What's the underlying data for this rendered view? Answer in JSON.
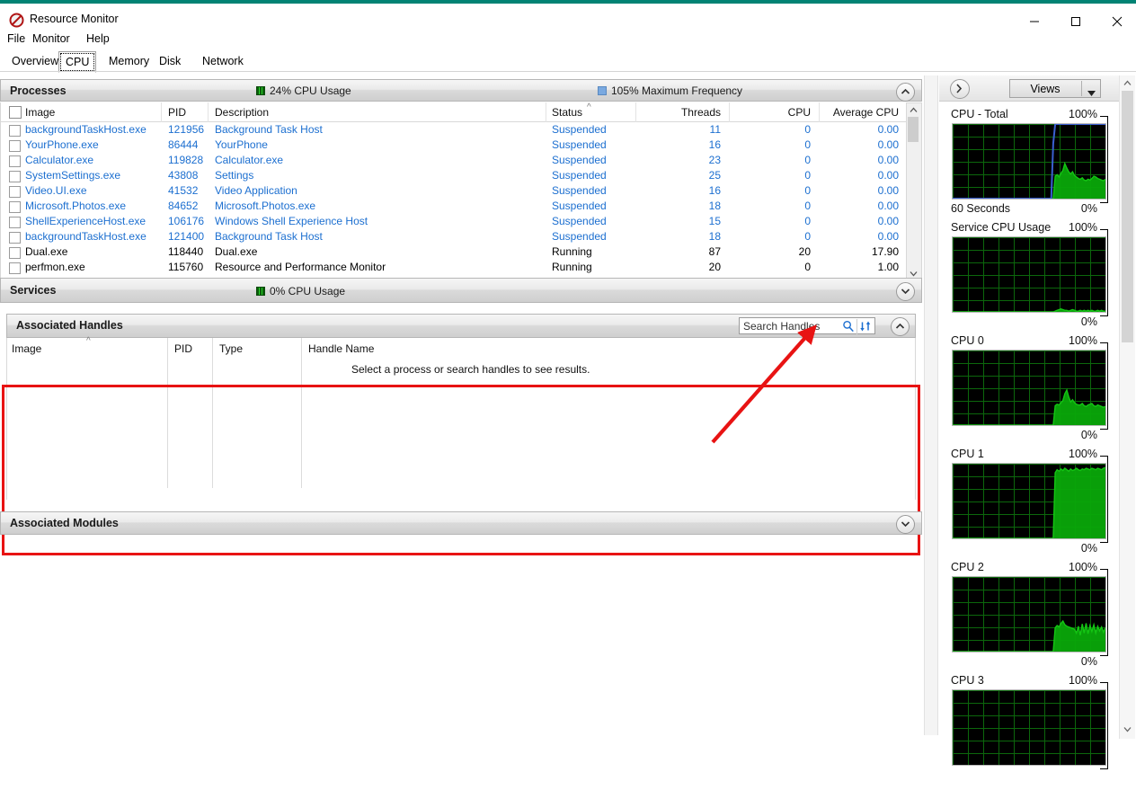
{
  "window": {
    "title": "Resource Monitor",
    "icon": "resource-monitor-icon",
    "minimize": "minimize-icon",
    "maximize": "maximize-icon",
    "close": "close-icon"
  },
  "menu": {
    "items": [
      "File",
      "Monitor",
      "Help"
    ]
  },
  "tabs": {
    "items": [
      "Overview",
      "CPU",
      "Memory",
      "Disk",
      "Network"
    ],
    "selected": "CPU"
  },
  "processes_panel": {
    "title": "Processes",
    "cpu_usage": "24% CPU Usage",
    "max_frequency": "105% Maximum Frequency",
    "collapse_icon": "chevron-up-icon",
    "columns": [
      "Image",
      "PID",
      "Description",
      "Status",
      "Threads",
      "CPU",
      "Average CPU"
    ],
    "sorted_column": "Status",
    "rows": [
      {
        "image": "backgroundTaskHost.exe",
        "pid": "121956",
        "description": "Background Task Host",
        "status": "Suspended",
        "threads": "11",
        "cpu": "0",
        "avg": "0.00"
      },
      {
        "image": "YourPhone.exe",
        "pid": "86444",
        "description": "YourPhone",
        "status": "Suspended",
        "threads": "16",
        "cpu": "0",
        "avg": "0.00"
      },
      {
        "image": "Calculator.exe",
        "pid": "119828",
        "description": "Calculator.exe",
        "status": "Suspended",
        "threads": "23",
        "cpu": "0",
        "avg": "0.00"
      },
      {
        "image": "SystemSettings.exe",
        "pid": "43808",
        "description": "Settings",
        "status": "Suspended",
        "threads": "25",
        "cpu": "0",
        "avg": "0.00"
      },
      {
        "image": "Video.UI.exe",
        "pid": "41532",
        "description": "Video Application",
        "status": "Suspended",
        "threads": "16",
        "cpu": "0",
        "avg": "0.00"
      },
      {
        "image": "Microsoft.Photos.exe",
        "pid": "84652",
        "description": "Microsoft.Photos.exe",
        "status": "Suspended",
        "threads": "18",
        "cpu": "0",
        "avg": "0.00"
      },
      {
        "image": "ShellExperienceHost.exe",
        "pid": "106176",
        "description": "Windows Shell Experience Host",
        "status": "Suspended",
        "threads": "15",
        "cpu": "0",
        "avg": "0.00"
      },
      {
        "image": "backgroundTaskHost.exe",
        "pid": "121400",
        "description": "Background Task Host",
        "status": "Suspended",
        "threads": "18",
        "cpu": "0",
        "avg": "0.00"
      },
      {
        "image": "Dual.exe",
        "pid": "118440",
        "description": "Dual.exe",
        "status": "Running",
        "threads": "87",
        "cpu": "20",
        "avg": "17.90"
      },
      {
        "image": "perfmon.exe",
        "pid": "115760",
        "description": "Resource and Performance Monitor",
        "status": "Running",
        "threads": "20",
        "cpu": "0",
        "avg": "1.00"
      }
    ]
  },
  "services_panel": {
    "title": "Services",
    "cpu_usage": "0% CPU Usage",
    "collapse_icon": "chevron-down-icon"
  },
  "handles_panel": {
    "title": "Associated Handles",
    "collapse_icon": "chevron-up-icon",
    "search": {
      "placeholder": "Search Handles",
      "value": "",
      "search_icon": "search-icon",
      "refresh_icon": "refresh-arrows-icon"
    },
    "columns": [
      "Image",
      "PID",
      "Type",
      "Handle Name"
    ],
    "sorted_column": "Image",
    "empty_message": "Select a process or search handles to see results.",
    "highlight_color": "#e81313"
  },
  "modules_panel": {
    "title": "Associated Modules",
    "collapse_icon": "chevron-down-icon"
  },
  "sidebar": {
    "expand_icon": "chevron-right-icon",
    "views_label": "Views",
    "views_caret": "caret-down-icon",
    "scroll_up_icon": "chevron-up-icon",
    "scroll_down_icon": "chevron-down-icon"
  },
  "chart_data": [
    {
      "type": "area",
      "title": "CPU - Total",
      "ymax_label": "100%",
      "ymin_label": "0%",
      "xlabel": "60 Seconds",
      "ylim": [
        0,
        100
      ],
      "grid": true,
      "series": [
        {
          "name": "CPU Usage",
          "color": "#14c514",
          "values": [
            0,
            0,
            0,
            0,
            0,
            0,
            0,
            0,
            0,
            0,
            0,
            0,
            0,
            0,
            0,
            0,
            0,
            0,
            0,
            0,
            0,
            0,
            0,
            0,
            0,
            0,
            0,
            0,
            0,
            0,
            0,
            0,
            0,
            0,
            0,
            0,
            0,
            0,
            0,
            0,
            0,
            0,
            0,
            0,
            0,
            0,
            0,
            0,
            0,
            0,
            0,
            0,
            0,
            30,
            32,
            29,
            34,
            38,
            47,
            41,
            36,
            33,
            36,
            31,
            29,
            27,
            26,
            28,
            25,
            24,
            26,
            25,
            27,
            30,
            29,
            27,
            26,
            25,
            24,
            26
          ]
        },
        {
          "name": "Maximum Frequency",
          "color": "#3a5fd0",
          "values": [
            0,
            0,
            0,
            0,
            0,
            0,
            0,
            0,
            0,
            0,
            0,
            0,
            0,
            0,
            0,
            0,
            0,
            0,
            0,
            0,
            0,
            0,
            0,
            0,
            0,
            0,
            0,
            0,
            0,
            0,
            0,
            0,
            0,
            0,
            0,
            0,
            0,
            0,
            0,
            0,
            0,
            0,
            0,
            0,
            0,
            0,
            0,
            0,
            0,
            0,
            0,
            0,
            74,
            100,
            100,
            100,
            100,
            100,
            100,
            100,
            100,
            100,
            100,
            100,
            100,
            100,
            100,
            100,
            100,
            100,
            100,
            100,
            100,
            100,
            100,
            100,
            100,
            100,
            100,
            100
          ]
        }
      ]
    },
    {
      "type": "area",
      "title": "Service CPU Usage",
      "ymax_label": "100%",
      "ymin_label": "0%",
      "ylim": [
        0,
        100
      ],
      "grid": true,
      "series": [
        {
          "name": "Service CPU Usage",
          "color": "#14c514",
          "values": [
            0,
            0,
            0,
            0,
            0,
            0,
            0,
            0,
            0,
            0,
            0,
            0,
            0,
            0,
            0,
            0,
            0,
            0,
            0,
            0,
            0,
            0,
            0,
            0,
            0,
            0,
            0,
            0,
            0,
            0,
            0,
            0,
            0,
            0,
            0,
            0,
            0,
            0,
            0,
            0,
            0,
            0,
            0,
            0,
            0,
            0,
            0,
            0,
            0,
            0,
            0,
            0,
            0,
            1,
            2,
            3,
            4,
            3,
            2,
            2,
            1,
            2,
            3,
            2,
            1,
            1,
            2,
            1,
            2,
            1,
            2,
            1,
            2,
            1,
            1,
            2,
            1,
            2,
            1,
            1
          ]
        }
      ]
    },
    {
      "type": "area",
      "title": "CPU 0",
      "ymax_label": "100%",
      "ymin_label": "0%",
      "ylim": [
        0,
        100
      ],
      "grid": true,
      "series": [
        {
          "name": "CPU 0",
          "color": "#14c514",
          "values": [
            0,
            0,
            0,
            0,
            0,
            0,
            0,
            0,
            0,
            0,
            0,
            0,
            0,
            0,
            0,
            0,
            0,
            0,
            0,
            0,
            0,
            0,
            0,
            0,
            0,
            0,
            0,
            0,
            0,
            0,
            0,
            0,
            0,
            0,
            0,
            0,
            0,
            0,
            0,
            0,
            0,
            0,
            0,
            0,
            0,
            0,
            0,
            0,
            0,
            0,
            0,
            0,
            0,
            26,
            28,
            27,
            30,
            33,
            42,
            47,
            38,
            31,
            34,
            30,
            28,
            27,
            27,
            29,
            26,
            25,
            27,
            28,
            29,
            26,
            25,
            27,
            26,
            25,
            24,
            25
          ]
        }
      ]
    },
    {
      "type": "area",
      "title": "CPU 1",
      "ymax_label": "100%",
      "ymin_label": "0%",
      "ylim": [
        0,
        100
      ],
      "grid": true,
      "series": [
        {
          "name": "CPU 1",
          "color": "#14c514",
          "values": [
            0,
            0,
            0,
            0,
            0,
            0,
            0,
            0,
            0,
            0,
            0,
            0,
            0,
            0,
            0,
            0,
            0,
            0,
            0,
            0,
            0,
            0,
            0,
            0,
            0,
            0,
            0,
            0,
            0,
            0,
            0,
            0,
            0,
            0,
            0,
            0,
            0,
            0,
            0,
            0,
            0,
            0,
            0,
            0,
            0,
            0,
            0,
            0,
            0,
            0,
            0,
            0,
            0,
            88,
            92,
            90,
            93,
            91,
            94,
            92,
            90,
            93,
            91,
            92,
            94,
            92,
            91,
            93,
            92,
            94,
            93,
            92,
            94,
            93,
            92,
            94,
            93,
            92,
            94,
            95
          ]
        }
      ]
    },
    {
      "type": "area",
      "title": "CPU 2",
      "ymax_label": "100%",
      "ymin_label": "0%",
      "ylim": [
        0,
        100
      ],
      "grid": true,
      "series": [
        {
          "name": "CPU 2",
          "color": "#14c514",
          "values": [
            0,
            0,
            0,
            0,
            0,
            0,
            0,
            0,
            0,
            0,
            0,
            0,
            0,
            0,
            0,
            0,
            0,
            0,
            0,
            0,
            0,
            0,
            0,
            0,
            0,
            0,
            0,
            0,
            0,
            0,
            0,
            0,
            0,
            0,
            0,
            0,
            0,
            0,
            0,
            0,
            0,
            0,
            0,
            0,
            0,
            0,
            0,
            0,
            0,
            0,
            0,
            0,
            0,
            32,
            35,
            33,
            38,
            41,
            36,
            34,
            33,
            32,
            31,
            30,
            25,
            34,
            22,
            37,
            25,
            38,
            24,
            35,
            27,
            36,
            25,
            34,
            28,
            33,
            26,
            32
          ]
        }
      ]
    },
    {
      "type": "area",
      "title": "CPU 3",
      "ymax_label": "100%",
      "ylim": [
        0,
        100
      ],
      "grid": true,
      "series": []
    }
  ]
}
